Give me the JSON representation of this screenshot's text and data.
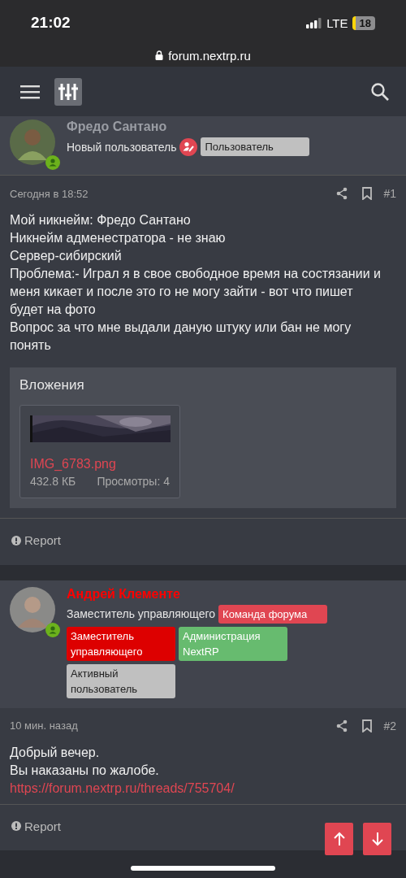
{
  "status_bar": {
    "time": "21:02",
    "network": "LTE",
    "battery": "18"
  },
  "address_bar": {
    "url": "forum.nextrp.ru"
  },
  "posts": [
    {
      "author": {
        "name": "Фредо Сантано",
        "color": "#9a9da4",
        "title": "Новый пользователь",
        "has_role_icon": true,
        "online": true,
        "badges": [
          {
            "label": "Пользователь",
            "color": "#c0c0c0"
          }
        ]
      },
      "date": "Сегодня в 18:52",
      "number": "#1",
      "lines": [
        "Мой никнейм: Фредо Сантано",
        "Никнейм адменестратора - не знаю",
        "Сервер-сибирский",
        "Проблема:- Играл я в свое свободное время на состязании и меня кикает и после это го не могу зайти - вот что пишет будет на фото",
        "Вопрос за что мне выдали даную штуку или бан не могу понять"
      ],
      "attachments": {
        "title": "Вложения",
        "files": [
          {
            "name": "IMG_6783.png",
            "size": "432.8 КБ",
            "views": "Просмотры: 4"
          }
        ]
      },
      "report": "Report"
    },
    {
      "author": {
        "name": "Андрей Клементе",
        "color": "#ff0000",
        "title": "Заместитель управляющего",
        "has_role_icon": false,
        "online": true,
        "badges": [
          {
            "label": "Команда форума",
            "color": "#e04652"
          },
          {
            "label": "Заместитель управляющего",
            "color": "#dd0000"
          },
          {
            "label": "Администрация NextRP",
            "color": "#67bb6f"
          },
          {
            "label": "Активный пользователь",
            "color": "#c0c0c0"
          }
        ]
      },
      "date": "10 мин. назад",
      "number": "#2",
      "lines": [
        "Добрый вечер.",
        "Вы наказаны по жалобе."
      ],
      "link": "https://forum.nextrp.ru/threads/755704/",
      "report": "Report"
    }
  ]
}
